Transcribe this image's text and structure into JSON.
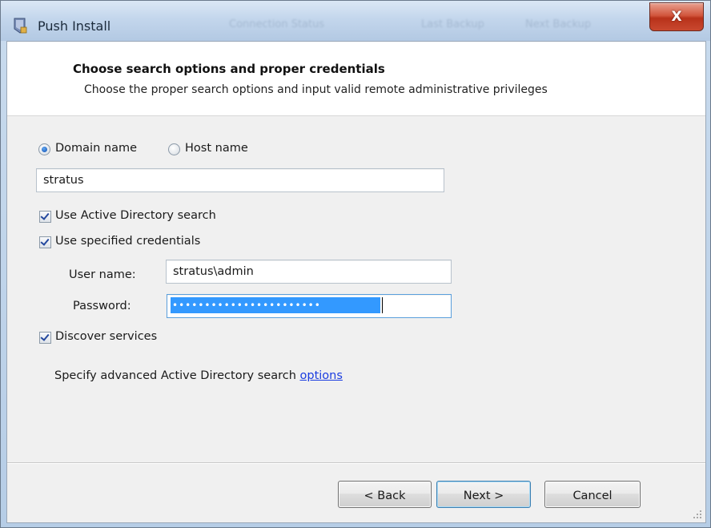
{
  "window": {
    "title": "Push Install",
    "background_tabs": [
      "Connection Status",
      "Last Backup",
      "Next Backup"
    ],
    "close_glyph": "X"
  },
  "header": {
    "title": "Choose search options and proper credentials",
    "subtitle": "Choose the proper search options and input valid remote administrative privileges"
  },
  "search_type": {
    "options": [
      {
        "label": "Domain name",
        "selected": true
      },
      {
        "label": "Host name",
        "selected": false
      }
    ]
  },
  "domain_field": {
    "value": "stratus"
  },
  "options": {
    "use_ad_search": {
      "label": "Use Active Directory search",
      "checked": true
    },
    "use_credentials": {
      "label": "Use specified credentials",
      "checked": true
    },
    "discover_services": {
      "label": "Discover services",
      "checked": true
    }
  },
  "credentials": {
    "username_label": "User name:",
    "username_value": "stratus\\admin",
    "password_label": "Password:",
    "password_mask": "•••••••••••••••••••••••"
  },
  "advanced": {
    "text": "Specify advanced Active Directory search",
    "link": "options"
  },
  "buttons": {
    "back": "< Back",
    "next": "Next >",
    "cancel": "Cancel"
  },
  "icons": [
    "app-icon",
    "close-icon",
    "size-grip-icon"
  ],
  "colors": {
    "link": "#1a3ce0",
    "selection": "#3399ff",
    "close_button": "#c9482f"
  }
}
